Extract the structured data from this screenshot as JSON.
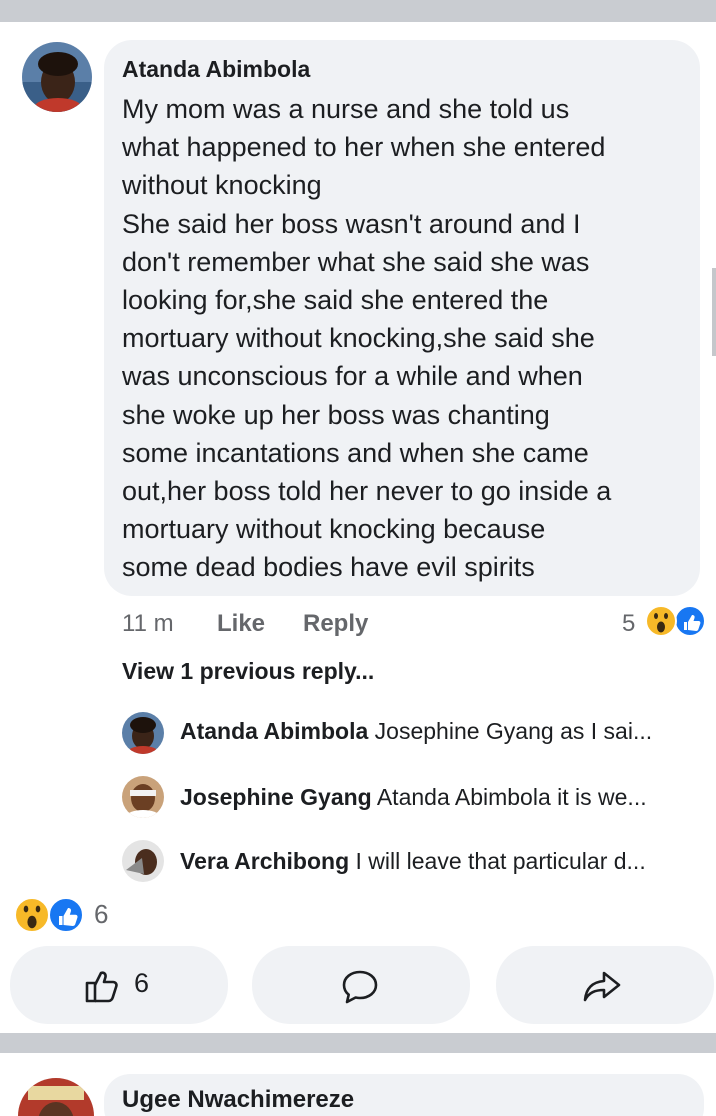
{
  "comment": {
    "author": "Atanda Abimbola",
    "lines": [
      "My mom was a nurse and she told us",
      "what happened to her when she entered",
      "without knocking",
      "She said her boss wasn't around and I",
      "don't remember what she said she was",
      "looking for,she said she entered the",
      "mortuary without knocking,she said she",
      "was unconscious for a while and when",
      "she woke up her boss was chanting",
      "some incantations and when she came",
      "out,her boss told her never to go inside a",
      "mortuary without knocking because",
      "some dead bodies have evil spirits"
    ],
    "time": "11 m",
    "like_label": "Like",
    "reply_label": "Reply",
    "reaction_count": "5",
    "reactions": [
      "wow-reaction-icon",
      "like-reaction-icon"
    ]
  },
  "view_previous": "View 1 previous reply...",
  "replies": [
    {
      "name": "Atanda Abimbola",
      "text": "Josephine Gyang as I sai..."
    },
    {
      "name": "Josephine Gyang",
      "text": "Atanda Abimbola it is we..."
    },
    {
      "name": "Vera Archibong",
      "text": "I will leave that particular d..."
    }
  ],
  "post": {
    "reaction_count": "6",
    "like_button_count": "6",
    "icons": [
      "like-outline-icon",
      "comment-bubble-icon",
      "share-arrow-icon"
    ]
  },
  "next_comment": {
    "author": "Ugee Nwachimereze"
  },
  "colors": {
    "bubble": "#f0f2f5",
    "separator": "#c9ccd1",
    "secondary_text": "#65676b",
    "like_blue": "#1877f2",
    "wow_yellow": "#f7b928"
  }
}
